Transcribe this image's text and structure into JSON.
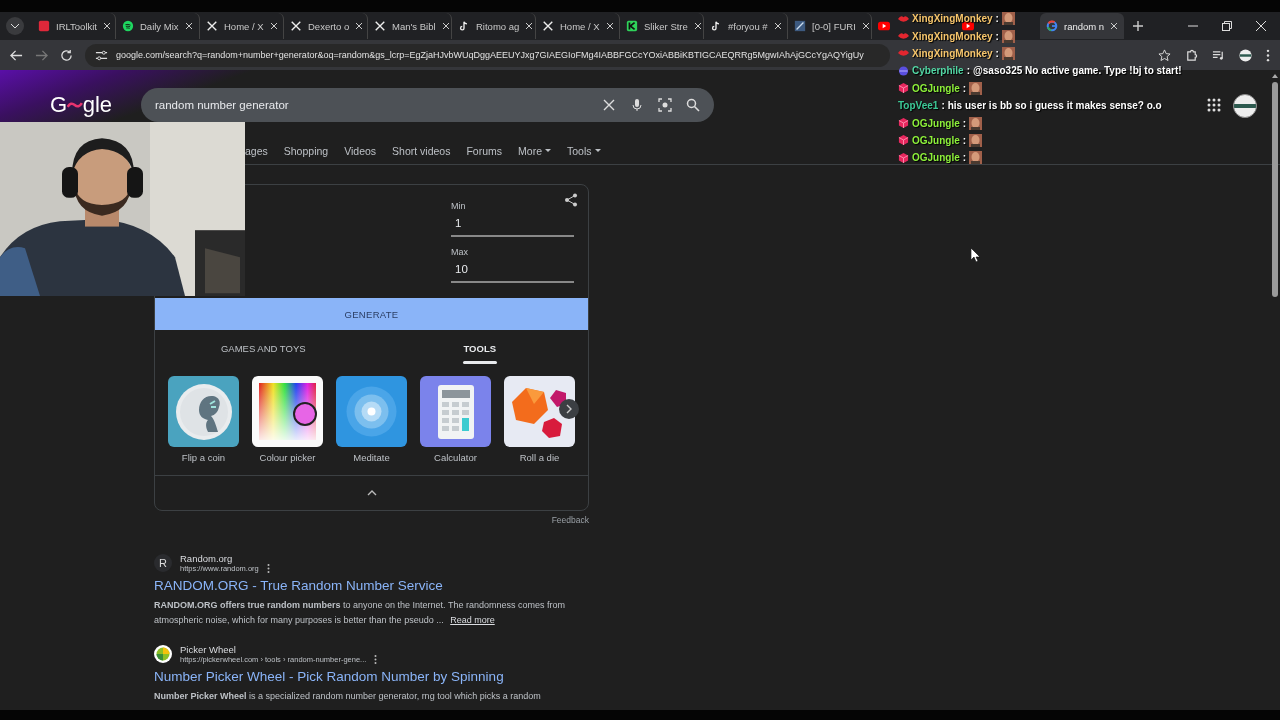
{
  "browser": {
    "tabs": [
      {
        "title": "IRLToolkit",
        "kind": "toolkit",
        "selected": false
      },
      {
        "title": "Daily Mix",
        "kind": "spotify",
        "selected": false
      },
      {
        "title": "Home / X",
        "kind": "x",
        "selected": false
      },
      {
        "title": "Dexerto o",
        "kind": "x",
        "selected": false
      },
      {
        "title": "Man's Bibl",
        "kind": "x",
        "selected": false
      },
      {
        "title": "Ritomo ag",
        "kind": "tiktok",
        "selected": false
      },
      {
        "title": "Home / X",
        "kind": "x",
        "selected": false
      },
      {
        "title": "Sliker Stre",
        "kind": "sliker",
        "selected": false
      },
      {
        "title": "#foryou #",
        "kind": "tiktok",
        "selected": false
      },
      {
        "title": "[0-0] FURI",
        "kind": "furi",
        "selected": false
      },
      {
        "kind": "youtube",
        "selected": false
      },
      {
        "kind": "youtube",
        "selected": false
      },
      {
        "title": "random n",
        "kind": "google",
        "selected": true
      }
    ],
    "url": "google.com/search?q=random+number+generator&oq=random&gs_lcrp=EgZjaHJvbWUqDggAEEUYJxg7GIAEGIoFMg4IABBFGCcYOxiABBiKBTIGCAEQRRg5MgwIAhAjGCcYgAQYigUy"
  },
  "search": {
    "logo": {
      "start": "G",
      "end": "gle"
    },
    "query": "random number generator",
    "nav": [
      "ages",
      "Shopping",
      "Videos",
      "Short videos",
      "Forums",
      "More",
      "Tools"
    ]
  },
  "generator": {
    "min_label": "Min",
    "min": "1",
    "max_label": "Max",
    "max": "10",
    "button": "GENERATE",
    "tabs": [
      {
        "label": "GAMES AND TOYS",
        "selected": false
      },
      {
        "label": "TOOLS",
        "selected": true
      }
    ],
    "tools": [
      {
        "label": "Flip a coin",
        "kind": "coin"
      },
      {
        "label": "Colour picker",
        "kind": "colour"
      },
      {
        "label": "Meditate",
        "kind": "meditate"
      },
      {
        "label": "Calculator",
        "kind": "calculator"
      },
      {
        "label": "Roll a die",
        "kind": "dice"
      }
    ],
    "feedback": "Feedback"
  },
  "results": [
    {
      "site": "Random.org",
      "kind": "letter",
      "favicon_text": "R",
      "url": "https://www.random.org",
      "title": "RANDOM.ORG - True Random Number Service",
      "snippet": "**RANDOM.ORG offers true random numbers** to anyone on the Internet. The randomness comes from atmospheric noise, which for many purposes is better than the pseudo ...",
      "more": "Read more"
    },
    {
      "site": "Picker Wheel",
      "kind": "wheel",
      "url": "https://pickerwheel.com › tools › random-number-gene...",
      "title": "Number Picker Wheel - Pick Random Number by Spinning",
      "snippet": "**Number Picker Wheel** is a specialized random number generator, rng tool which picks a random"
    }
  ],
  "chat": [
    {
      "user": "XingXingMonkey",
      "color": "#f6c56b",
      "badge": {
        "kind": "lips"
      },
      "colon": ":",
      "kind": "emote"
    },
    {
      "user": "XingXingMonkey",
      "color": "#f6c56b",
      "badge": {
        "kind": "lips"
      },
      "colon": ":",
      "kind": "emote"
    },
    {
      "user": "XingXingMonkey",
      "color": "#f6c56b",
      "badge": {
        "kind": "lips"
      },
      "colon": ":",
      "kind": "emote"
    },
    {
      "user": "Cyberphile",
      "color": "#52d6a4",
      "badge": {
        "kind": "globe"
      },
      "colon": ":",
      "kind": "text",
      "text": "@saso325 No active game. Type !bj to start!"
    },
    {
      "user": "OGJungle",
      "color": "#8df03a",
      "badge": {
        "kind": "cube"
      },
      "colon": ":",
      "kind": "emote"
    },
    {
      "user": "TopVee1",
      "color": "#3cc896",
      "colon": ":",
      "kind": "text",
      "text": "his user is bb so i guess it makes sense? o.o"
    },
    {
      "user": "OGJungle",
      "color": "#8df03a",
      "badge": {
        "kind": "cube"
      },
      "colon": ":",
      "kind": "emote"
    },
    {
      "user": "OGJungle",
      "color": "#8df03a",
      "badge": {
        "kind": "cube"
      },
      "colon": ":",
      "kind": "emote"
    },
    {
      "user": "OGJungle",
      "color": "#8df03a",
      "badge": {
        "kind": "cube"
      },
      "colon": ":",
      "kind": "emote"
    }
  ]
}
